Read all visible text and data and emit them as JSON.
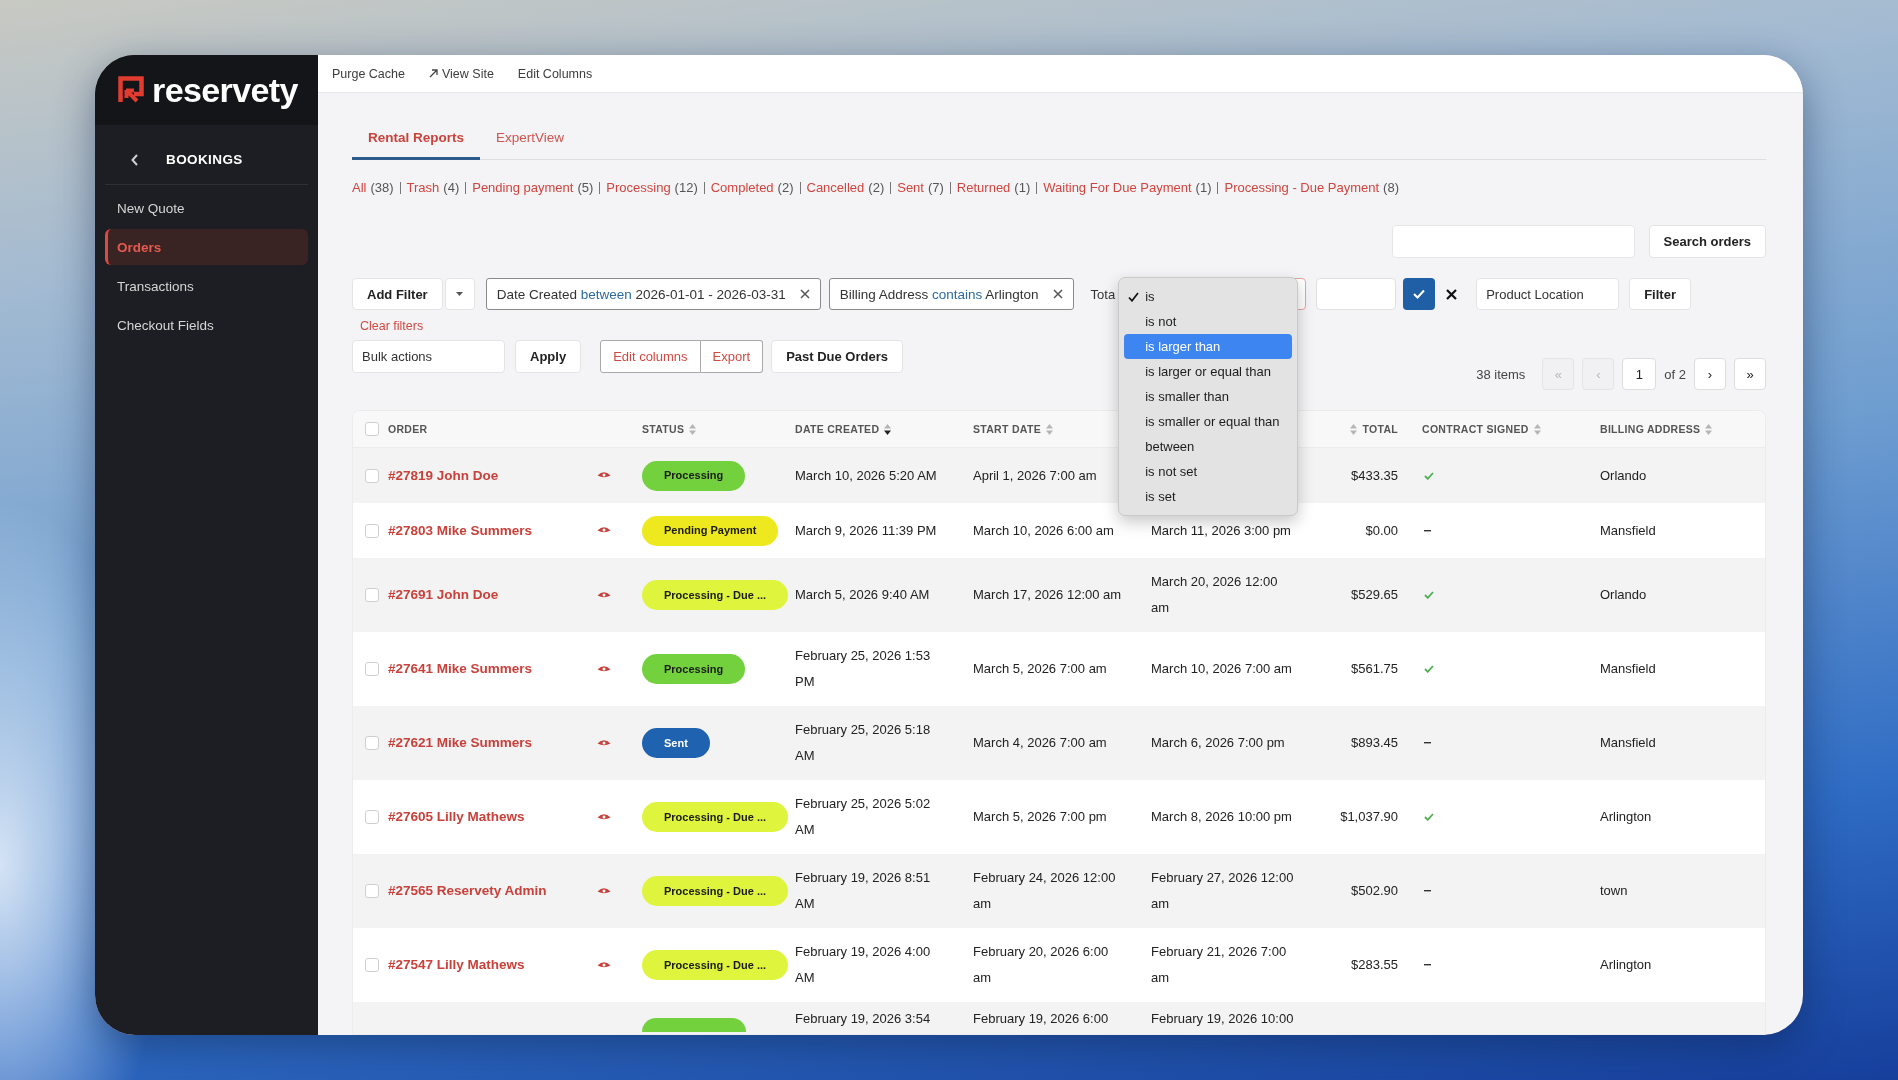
{
  "sidebar": {
    "logo": "reservety",
    "section": "BOOKINGS",
    "items": [
      {
        "label": "New Quote",
        "selected": false
      },
      {
        "label": "Orders",
        "selected": true
      },
      {
        "label": "Transactions",
        "selected": false
      },
      {
        "label": "Checkout Fields",
        "selected": false
      }
    ]
  },
  "toolbar": [
    {
      "label": "Purge Cache",
      "kind": "plain"
    },
    {
      "label": "View Site",
      "kind": "external"
    },
    {
      "label": "Edit Columns",
      "kind": "plain"
    }
  ],
  "tabs": [
    {
      "label": "Rental Reports",
      "selected": true
    },
    {
      "label": "ExpertView",
      "selected": false
    }
  ],
  "status_filters": [
    {
      "label": "All",
      "count": "(38)"
    },
    {
      "label": "Trash",
      "count": "(4)"
    },
    {
      "label": "Pending payment",
      "count": "(5)"
    },
    {
      "label": "Processing",
      "count": "(12)"
    },
    {
      "label": "Completed",
      "count": "(2)"
    },
    {
      "label": "Cancelled",
      "count": "(2)"
    },
    {
      "label": "Sent",
      "count": "(7)"
    },
    {
      "label": "Returned",
      "count": "(1)"
    },
    {
      "label": "Waiting For Due Payment",
      "count": "(1)"
    },
    {
      "label": "Processing - Due Payment",
      "count": "(8)"
    }
  ],
  "search": {
    "button": "Search orders"
  },
  "filters": {
    "add_button": "Add Filter",
    "chips": [
      {
        "field": "Date Created",
        "operator": "between",
        "value": "2026-01-01 - 2026-03-31"
      },
      {
        "field": "Billing Address",
        "operator": "contains",
        "value": "Arlington"
      }
    ],
    "open_filter": {
      "field": "Tota",
      "options": [
        {
          "label": "is",
          "selected": true,
          "hovered": false
        },
        {
          "label": "is not",
          "selected": false,
          "hovered": false
        },
        {
          "label": "is larger than",
          "selected": false,
          "hovered": true
        },
        {
          "label": "is larger or equal than",
          "selected": false,
          "hovered": false
        },
        {
          "label": "is smaller than",
          "selected": false,
          "hovered": false
        },
        {
          "label": "is smaller or equal than",
          "selected": false,
          "hovered": false
        },
        {
          "label": "between",
          "selected": false,
          "hovered": false
        },
        {
          "label": "is not set",
          "selected": false,
          "hovered": false
        },
        {
          "label": "is set",
          "selected": false,
          "hovered": false
        }
      ]
    },
    "location_select": "Product Location",
    "apply_button": "Filter",
    "clear_link": "Clear filters"
  },
  "bulk": {
    "select": "Bulk actions",
    "apply_button": "Apply",
    "column_buttons": [
      "Edit columns",
      "Export"
    ],
    "past_due_button": "Past Due Orders"
  },
  "pagination": {
    "summary": "38 items",
    "controls": [
      {
        "kind": "button",
        "label": "«",
        "disabled": true
      },
      {
        "kind": "button",
        "label": "‹",
        "disabled": true
      },
      {
        "kind": "page",
        "label": "1"
      },
      {
        "kind": "total",
        "label": "of 2"
      },
      {
        "kind": "button",
        "label": "›",
        "disabled": false
      },
      {
        "kind": "button",
        "label": "»",
        "disabled": false
      }
    ]
  },
  "table": {
    "select_all": false,
    "columns": [
      {
        "label": "ORDER",
        "kind": "order",
        "sortable": false
      },
      {
        "label": "STATUS",
        "kind": "status",
        "sortable": true,
        "sorted": false
      },
      {
        "label": "DATE CREATED",
        "kind": "created",
        "sortable": true,
        "sorted": true
      },
      {
        "label": "START DATE",
        "kind": "start",
        "sortable": true,
        "sorted": false
      },
      {
        "label": "TOTAL",
        "kind": "total",
        "sortable": true,
        "sorted": false
      },
      {
        "label": "CONTRACT SIGNED",
        "kind": "contract",
        "sortable": true,
        "sorted": false
      },
      {
        "label": "BILLING ADDRESS",
        "kind": "address",
        "sortable": true,
        "sorted": false
      }
    ],
    "rows": [
      {
        "order": "#27819 John Doe",
        "selected": false,
        "status": {
          "label": "Processing",
          "color": "#72d13c"
        },
        "date_created": "March 10, 2026 5:20 AM",
        "start_date": "April 1, 2026 7:00 am",
        "total": "$433.35",
        "contract_signed": true,
        "billing_address": "Orlando"
      },
      {
        "order": "#27803 Mike Summers",
        "selected": false,
        "status": {
          "label": "Pending Payment",
          "color": "#eee81e"
        },
        "date_created": "March 9, 2026 11:39 PM",
        "start_date": "March 10, 2026 6:00 am",
        "end_date": "March 11, 2026 3:00 pm",
        "total": "$0.00",
        "contract_signed": false,
        "billing_address": "Mansfield"
      },
      {
        "order": "#27691 John Doe",
        "selected": false,
        "status": {
          "label": "Processing - Due ...",
          "color": "#dff43c"
        },
        "date_created": "March 5, 2026 9:40 AM",
        "start_date": "March 17, 2026 12:00 am",
        "end_date": "March 20, 2026 12:00 am",
        "total": "$529.65",
        "contract_signed": true,
        "billing_address": "Orlando"
      },
      {
        "order": "#27641 Mike Summers",
        "selected": false,
        "status": {
          "label": "Processing",
          "color": "#72d13c"
        },
        "date_created": "February 25, 2026 1:53 PM",
        "start_date": "March 5, 2026 7:00 am",
        "end_date": "March 10, 2026 7:00 am",
        "total": "$561.75",
        "contract_signed": true,
        "billing_address": "Mansfield"
      },
      {
        "order": "#27621 Mike Summers",
        "selected": false,
        "status": {
          "label": "Sent",
          "color": "#1e62b0"
        },
        "date_created": "February 25, 2026 5:18 AM",
        "start_date": "March 4, 2026 7:00 am",
        "end_date": "March 6, 2026 7:00 pm",
        "total": "$893.45",
        "contract_signed": false,
        "billing_address": "Mansfield"
      },
      {
        "order": "#27605 Lilly Mathews",
        "selected": false,
        "status": {
          "label": "Processing - Due ...",
          "color": "#dff43c"
        },
        "date_created": "February 25, 2026 5:02 AM",
        "start_date": "March 5, 2026 7:00 pm",
        "end_date": "March 8, 2026 10:00 pm",
        "total": "$1,037.90",
        "contract_signed": true,
        "billing_address": "Arlington"
      },
      {
        "order": "#27565 Reservety Admin",
        "selected": false,
        "status": {
          "label": "Processing - Due ...",
          "color": "#dff43c"
        },
        "date_created": "February 19, 2026 8:51 AM",
        "start_date": "February 24, 2026 12:00 am",
        "end_date": "February 27, 2026 12:00 am",
        "total": "$502.90",
        "contract_signed": false,
        "billing_address": "town"
      },
      {
        "order": "#27547 Lilly Mathews",
        "selected": false,
        "status": {
          "label": "Processing - Due ...",
          "color": "#dff43c"
        },
        "date_created": "February 19, 2026 4:00 AM",
        "start_date": "February 20, 2026 6:00 am",
        "end_date": "February 21, 2026 7:00 am",
        "total": "$283.55",
        "contract_signed": false,
        "billing_address": "Arlington"
      }
    ],
    "partial_row": {
      "status": {
        "color": "#72d13c"
      },
      "date_created": "February 19, 2026 3:54",
      "start_date": "February 19, 2026 6:00",
      "end_date": "February 19, 2026 10:00"
    }
  }
}
